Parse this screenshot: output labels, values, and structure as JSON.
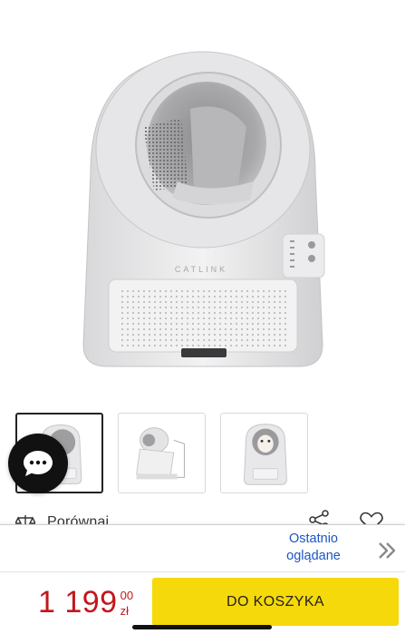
{
  "hero": {
    "image_alt": "product-main-image",
    "logo_text": "CATLINK"
  },
  "thumbnails": [
    {
      "name": "thumbnail-1",
      "selected": true
    },
    {
      "name": "thumbnail-2",
      "selected": false
    },
    {
      "name": "thumbnail-3",
      "selected": false
    }
  ],
  "chat": {
    "icon": "chat-bubble-icon"
  },
  "actions": {
    "compare_label": "Porównaj",
    "compare_icon": "compare-scale-icon",
    "share_icon": "share-icon",
    "favorite_icon": "heart-icon"
  },
  "recently_viewed": {
    "label_line1": "Ostatnio",
    "label_line2": "oglądane",
    "icon": "double-chevron-right-icon"
  },
  "purchase": {
    "price_main": "1 199",
    "price_cents": "00",
    "currency": "zł",
    "add_to_cart": "DO KOSZYKA"
  },
  "colors": {
    "price": "#c4161c",
    "cart_button": "#f5d90a",
    "link": "#1a56c4"
  }
}
